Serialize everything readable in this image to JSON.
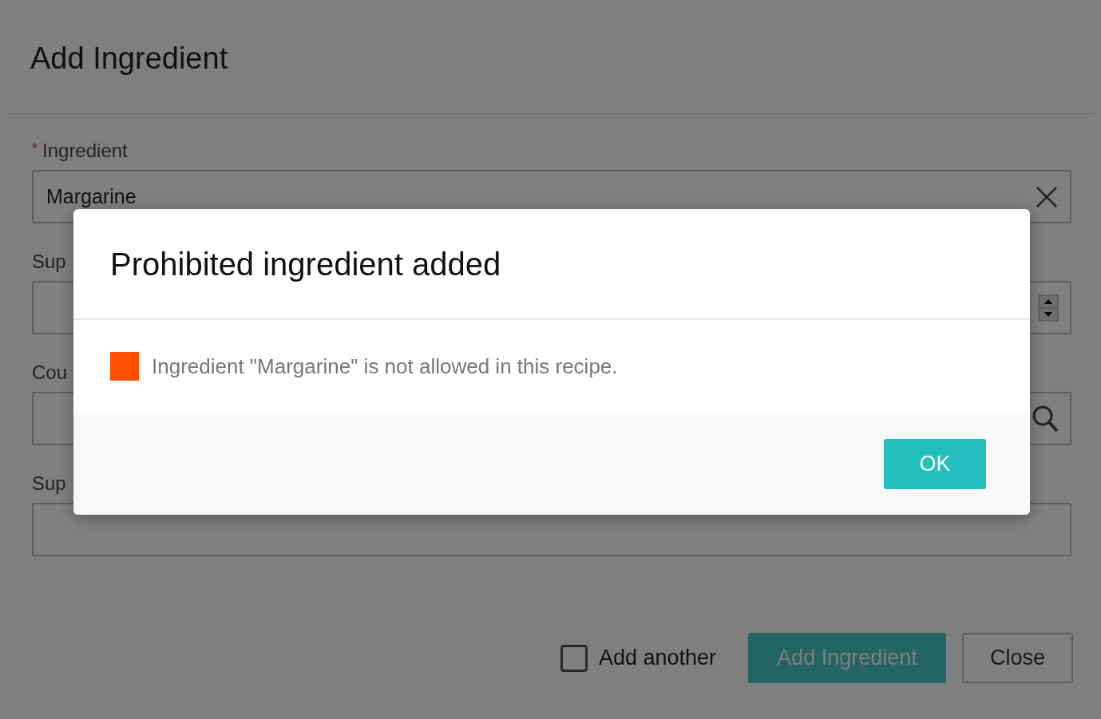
{
  "dialog": {
    "title": "Add Ingredient",
    "fields": [
      {
        "marker": "*",
        "label": "Ingredient",
        "value": "Margarine",
        "kind": "clear"
      },
      {
        "label": "Sup",
        "kind": "spinner"
      },
      {
        "label": "Cou",
        "kind": "search"
      },
      {
        "label": "Sup",
        "kind": "plain"
      }
    ],
    "add_another": {
      "label": "Add another",
      "checked": false
    },
    "buttons": [
      {
        "label": "Add Ingredient",
        "kind": "primary"
      },
      {
        "label": "Close",
        "kind": "secondary"
      }
    ]
  },
  "alert": {
    "title": "Prohibited ingredient added",
    "message": "Ingredient \"Margarine\" is not allowed in this recipe.",
    "button": "OK"
  }
}
